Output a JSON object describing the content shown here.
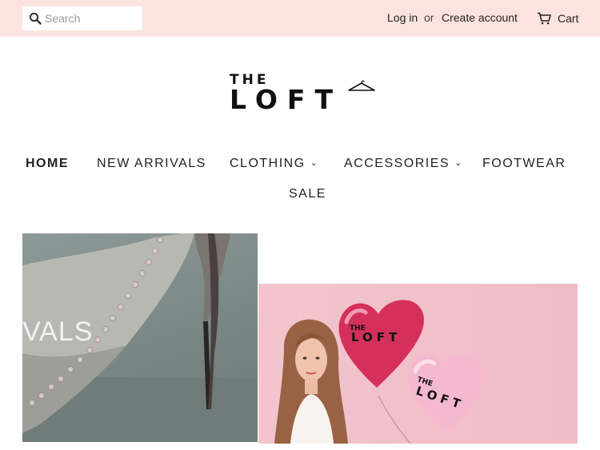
{
  "topbar": {
    "search_placeholder": "Search",
    "login": "Log in",
    "or": "or",
    "create_account": "Create account",
    "cart": "Cart"
  },
  "logo": {
    "line1": "THE",
    "line2": "LOFT"
  },
  "nav": {
    "items": [
      {
        "label": "HOME",
        "active": true
      },
      {
        "label": "NEW ARRIVALS"
      },
      {
        "label": "CLOTHING",
        "dropdown": true
      },
      {
        "label": "ACCESSORIES",
        "dropdown": true
      },
      {
        "label": "FOOTWEAR"
      },
      {
        "label": "SALE"
      }
    ],
    "chevron": "⌄"
  },
  "banners": {
    "left_caption": "VALS",
    "balloon_line1": "THE",
    "balloon_line2": "LOFT"
  },
  "colors": {
    "topbar_bg": "#fde3df",
    "banner_pink": "#f1c0ca",
    "balloon_red": "#d4305b",
    "balloon_pink": "#f4b8cf"
  },
  "icons": [
    "search-icon",
    "cart-icon",
    "hanger-icon",
    "chevron-down-icon"
  ]
}
